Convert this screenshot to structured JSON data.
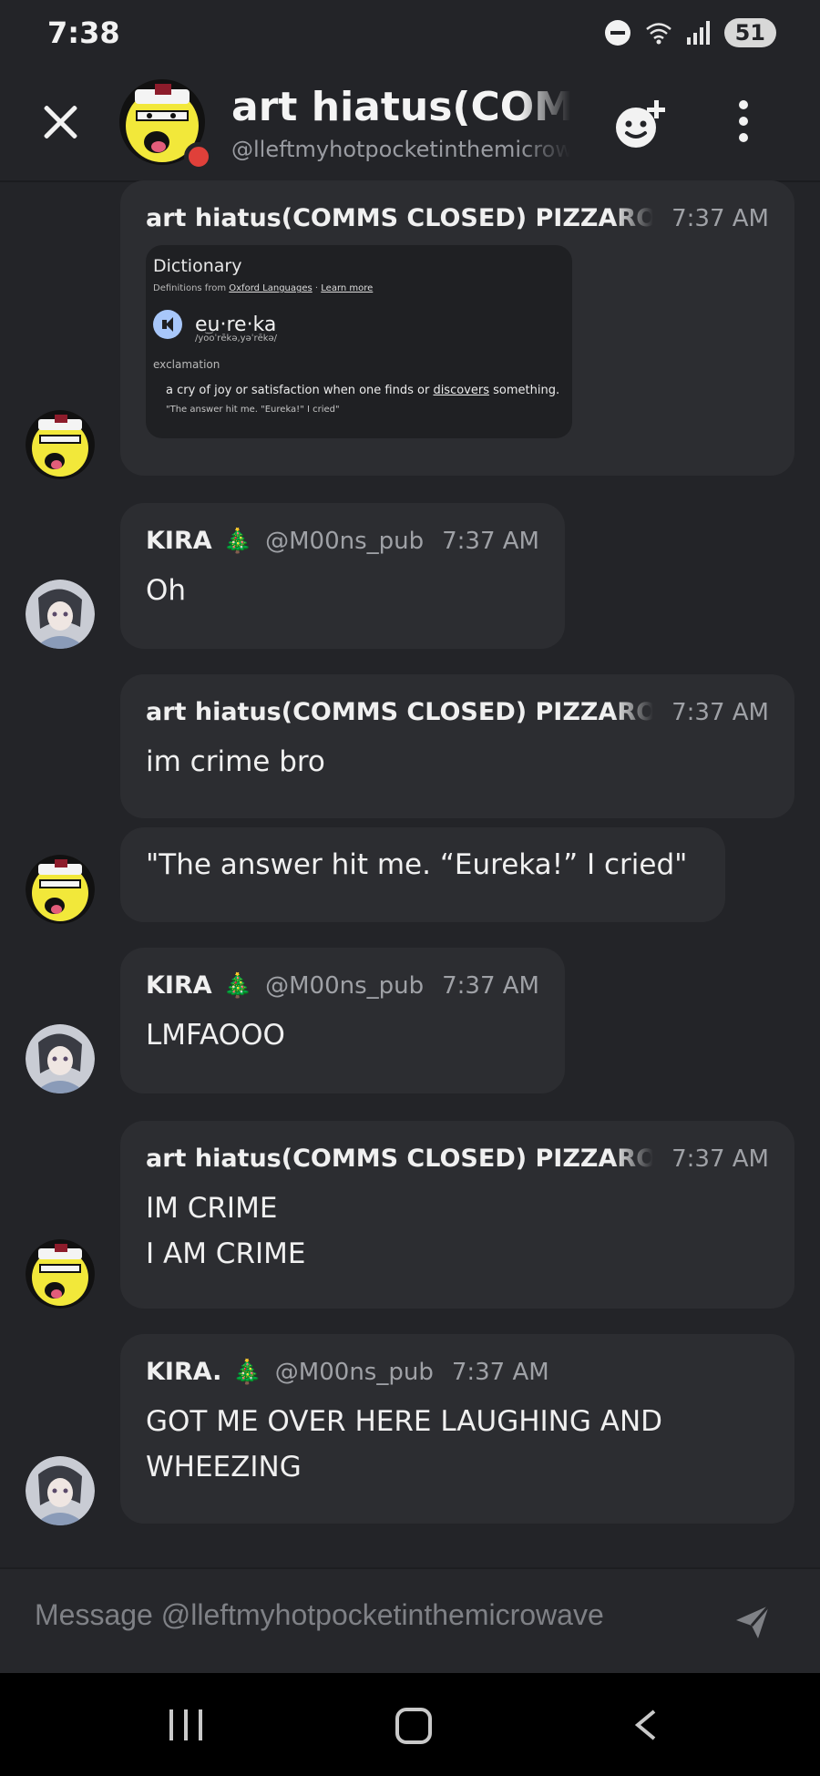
{
  "status_bar": {
    "time": "7:38",
    "battery": "51",
    "wifi_label": "5"
  },
  "header": {
    "title": "art hiatus(COMMS CLOSED) PIZZARO",
    "subtitle": "@lleftmyhotpocketinthemicrowave"
  },
  "messages": [
    {
      "author": "art hiatus(COMMS CLOSED) PIZZARO",
      "time": "7:37 AM",
      "embed": {
        "title": "Dictionary",
        "source_prefix": "Definitions from ",
        "source_link": "Oxford Languages",
        "source_sep": " · ",
        "learn_more": "Learn more",
        "word": "eu·re·ka",
        "pronunciation": "/yo͝oˈrēkə,yəˈrēkə/",
        "part_of_speech": "exclamation",
        "definition_prefix": "a cry of joy or satisfaction when one finds or ",
        "definition_link": "discovers",
        "definition_suffix": " something.",
        "example": "\"The answer hit me. \"Eureka!\" I cried\""
      }
    },
    {
      "author": "KIRA.",
      "emoji": "🎄",
      "handle": "@M00ns_pub",
      "time": "7:37 AM",
      "text": "Oh"
    },
    {
      "author": "art hiatus(COMMS CLOSED) PIZZARO",
      "time": "7:37 AM",
      "text": "im crime bro"
    },
    {
      "text": "\"The answer hit me. “Eureka!” I cried\""
    },
    {
      "author": "KIRA.",
      "emoji": "🎄",
      "handle": "@M00ns_pub",
      "time": "7:37 AM",
      "text": "LMFAOOO"
    },
    {
      "author": "art hiatus(COMMS CLOSED) PIZZARO",
      "time": "7:37 AM",
      "text": "IM CRIME\nI AM CRIME"
    },
    {
      "author": "KIRA.",
      "emoji": "🎄",
      "handle": "@M00ns_pub",
      "time": "7:37 AM",
      "text": "GOT ME OVER HERE LAUGHING AND\nWHEEZING"
    }
  ],
  "composer": {
    "placeholder": "Message @lleftmyhotpocketinthemicrowave"
  }
}
